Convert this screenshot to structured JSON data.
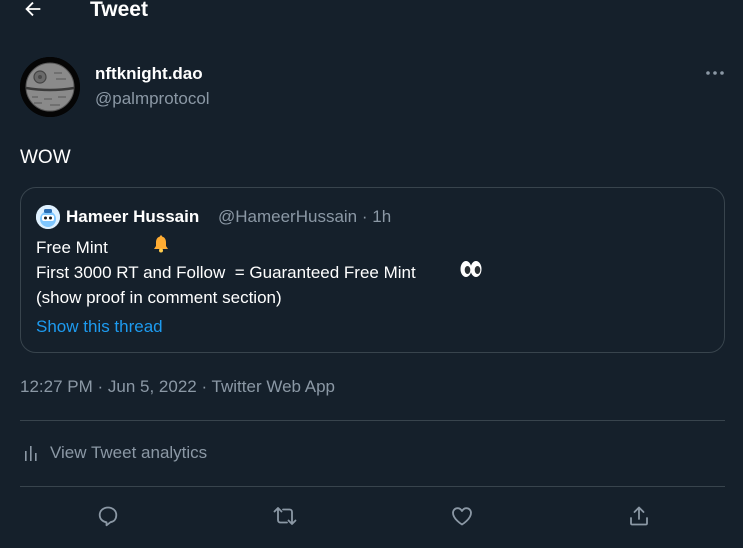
{
  "header": {
    "title": "Tweet",
    "back_icon": "arrow-left-icon"
  },
  "author": {
    "name": "nftknight.dao",
    "handle": "@palmprotocol",
    "avatar_icon": "death-star-avatar"
  },
  "tweet": {
    "text": "WOW"
  },
  "quoted": {
    "name": "Hameer Hussain",
    "handle_time": "@HameerHussain · 1h",
    "lines": [
      "Free Mint",
      "First 3000 RT and Follow  = Guaranteed Free Mint",
      "(show proof in comment section)"
    ],
    "emojis": [
      "bell-emoji",
      "eyes-emoji"
    ],
    "show_thread": "Show this thread"
  },
  "meta": {
    "time": "12:27 PM",
    "date": "Jun 5, 2022",
    "source": "Twitter Web App",
    "separator": " · "
  },
  "analytics": {
    "label": "View Tweet analytics",
    "icon": "bar-chart-icon"
  },
  "actions": [
    {
      "name": "reply",
      "icon": "reply-icon"
    },
    {
      "name": "retweet",
      "icon": "retweet-icon"
    },
    {
      "name": "like",
      "icon": "heart-icon"
    },
    {
      "name": "share",
      "icon": "share-icon"
    }
  ],
  "colors": {
    "background": "#15202b",
    "border": "#38444d",
    "secondary_text": "#8b98a5",
    "link": "#1d9bf0",
    "text": "#ffffff"
  }
}
